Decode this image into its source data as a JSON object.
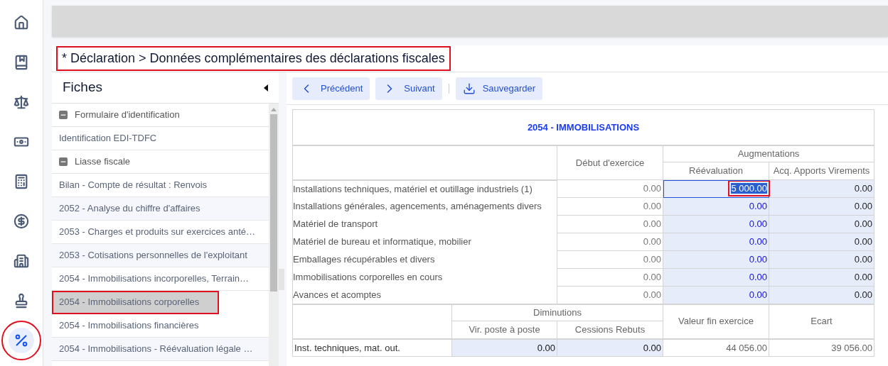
{
  "nav": [
    {
      "kind": "home",
      "selected": false
    },
    {
      "kind": "book",
      "selected": false
    },
    {
      "kind": "scale",
      "selected": false
    },
    {
      "kind": "money",
      "selected": false
    },
    {
      "kind": "calculator",
      "selected": false
    },
    {
      "kind": "dollar",
      "selected": false
    },
    {
      "kind": "building",
      "selected": false
    },
    {
      "kind": "stamp",
      "selected": false
    },
    {
      "kind": "percent",
      "selected": true,
      "highlighted": true
    }
  ],
  "breadcrumb": {
    "text": "* Déclaration > Données complémentaires des déclarations fiscales",
    "highlighted": true
  },
  "sidebar": {
    "title": "Fiches",
    "items": [
      {
        "label": "Formulaire d'identification",
        "expanded": true,
        "children": [
          {
            "label": "Identification EDI-TDFC",
            "selected": false,
            "highlighted": false
          }
        ]
      },
      {
        "label": "Liasse fiscale",
        "expanded": true,
        "children": [
          {
            "label": "Bilan - Compte de résultat : Renvois",
            "selected": false,
            "highlighted": false
          },
          {
            "label": "2052 - Analyse du chiffre d'affaires",
            "selected": false,
            "highlighted": false
          },
          {
            "label": "2053 - Charges et produits sur exercices anté…",
            "selected": false,
            "highlighted": false
          },
          {
            "label": "2053 - Cotisations personnelles de l'exploitant",
            "selected": false,
            "highlighted": false
          },
          {
            "label": "2054 - Immobilisations incorporelles, Terrain…",
            "selected": false,
            "highlighted": false
          },
          {
            "label": "2054 - Immobilisations corporelles",
            "selected": true,
            "highlighted": true
          },
          {
            "label": "2054 - Immobilisations financières",
            "selected": false,
            "highlighted": false
          },
          {
            "label": "2054 - Immobilisations - Réévaluation légale …",
            "selected": false,
            "highlighted": false
          }
        ]
      }
    ]
  },
  "toolbar": [
    {
      "kind": "previous",
      "label": "Précédent"
    },
    {
      "kind": "next",
      "label": "Suivant"
    },
    {
      "kind": "save",
      "label": "Sauvegarder"
    }
  ],
  "table": {
    "title": "2054 - IMMOBILISATIONS",
    "header": {
      "column_2": "Début d'exercice",
      "group": "Augmentations",
      "column_3": "Réévaluation",
      "column_4": "Acq. Apports Virements"
    },
    "rows": [
      {
        "label": "Installations techniques, matériel et outillage industriels (1)",
        "values": [
          "0.00",
          "5 000.00",
          "0.00"
        ],
        "focused": true,
        "highlighted": true
      },
      {
        "label": "Installations générales, agencements, aménagements divers",
        "values": [
          "0.00",
          "0.00",
          "0.00"
        ],
        "focused": false,
        "highlighted": false
      },
      {
        "label": "Matériel de transport",
        "values": [
          "0.00",
          "0.00",
          "0.00"
        ],
        "focused": false,
        "highlighted": false
      },
      {
        "label": "Matériel de bureau et informatique, mobilier",
        "values": [
          "0.00",
          "0.00",
          "0.00"
        ],
        "focused": false,
        "highlighted": false
      },
      {
        "label": "Emballages récupérables et divers",
        "values": [
          "0.00",
          "0.00",
          "0.00"
        ],
        "focused": false,
        "highlighted": false
      },
      {
        "label": "Immobilisations corporelles en cours",
        "values": [
          "0.00",
          "0.00",
          "0.00"
        ],
        "focused": false,
        "highlighted": false
      },
      {
        "label": "Avances et acomptes",
        "values": [
          "0.00",
          "0.00",
          "0.00"
        ],
        "focused": false,
        "highlighted": false
      }
    ],
    "header2": {
      "group": "Diminutions",
      "column_2": "Vir. poste à poste",
      "column_3": "Cessions Rebuts",
      "column_4": "Valeur fin exercice",
      "column_5": "Ecart"
    },
    "rows2": [
      {
        "label": "Inst. techniques, mat. out.",
        "values": [
          "0.00",
          "0.00",
          "44 056.00",
          "39 056.00"
        ]
      }
    ]
  }
}
